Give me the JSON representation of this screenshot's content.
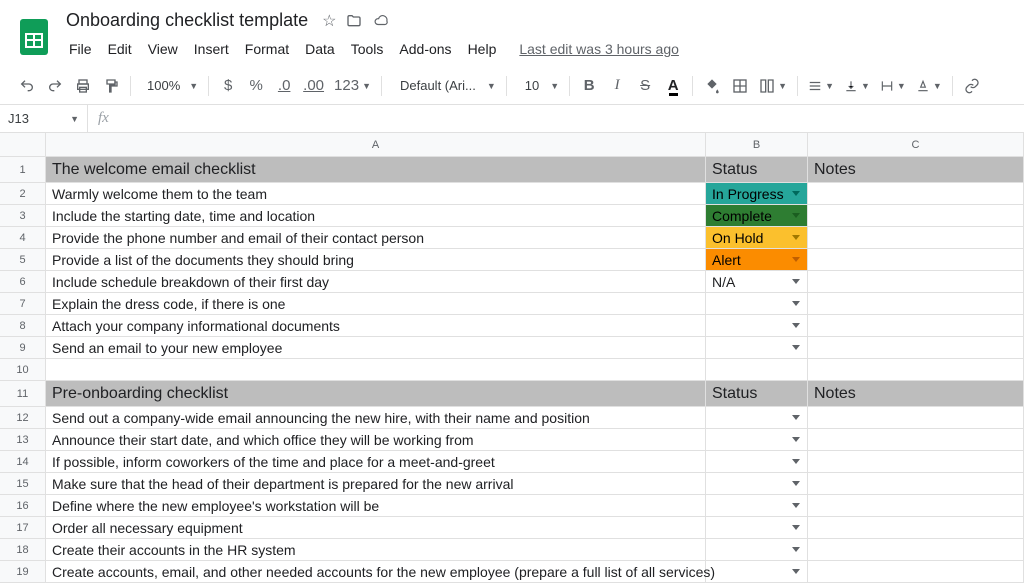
{
  "doc": {
    "title": "Onboarding checklist template"
  },
  "menus": [
    "File",
    "Edit",
    "View",
    "Insert",
    "Format",
    "Data",
    "Tools",
    "Add-ons",
    "Help"
  ],
  "last_edit": "Last edit was 3 hours ago",
  "toolbar": {
    "zoom": "100%",
    "font": "Default (Ari...",
    "font_size": "10",
    "format_dollar": "$",
    "format_percent": "%",
    "format_dec_dec": ".0",
    "format_dec_inc": ".00",
    "format_more": "123"
  },
  "name_box": "J13",
  "fx_label": "fx",
  "columns": [
    "A",
    "B",
    "C"
  ],
  "header_labels": {
    "status": "Status",
    "notes": "Notes"
  },
  "sections": [
    {
      "title": "The welcome email checklist",
      "rows": [
        {
          "text": "Warmly welcome them to the team",
          "status": "In Progress",
          "status_class": "st-inprogress"
        },
        {
          "text": "Include the starting date, time and location",
          "status": "Complete",
          "status_class": "st-complete"
        },
        {
          "text": "Provide the phone number and email of their contact person",
          "status": "On Hold",
          "status_class": "st-onhold"
        },
        {
          "text": "Provide a list of the documents they should bring",
          "status": "Alert",
          "status_class": "st-alert"
        },
        {
          "text": "Include schedule breakdown of their first day",
          "status": "N/A",
          "status_class": ""
        },
        {
          "text": "Explain the dress code, if there is one",
          "status": "",
          "status_class": ""
        },
        {
          "text": "Attach your company informational documents",
          "status": "",
          "status_class": ""
        },
        {
          "text": "Send an email to your new employee",
          "status": "",
          "status_class": ""
        }
      ]
    },
    {
      "title": "Pre-onboarding checklist",
      "rows": [
        {
          "text": "Send out a company-wide email announcing the new hire, with their name and position",
          "status": "",
          "status_class": ""
        },
        {
          "text": "Announce their start date, and which office they will be working from",
          "status": "",
          "status_class": ""
        },
        {
          "text": "If possible, inform coworkers of the time and place for a meet-and-greet",
          "status": "",
          "status_class": ""
        },
        {
          "text": "Make sure that the head of their department is prepared for the new arrival",
          "status": "",
          "status_class": ""
        },
        {
          "text": "Define where the new employee's workstation will be",
          "status": "",
          "status_class": ""
        },
        {
          "text": "Order all necessary equipment",
          "status": "",
          "status_class": ""
        },
        {
          "text": "Create their accounts in the HR system",
          "status": "",
          "status_class": ""
        },
        {
          "text": "Create accounts, email, and other needed accounts for the new employee (prepare a full list of all services)",
          "status": "",
          "status_class": ""
        }
      ]
    }
  ]
}
